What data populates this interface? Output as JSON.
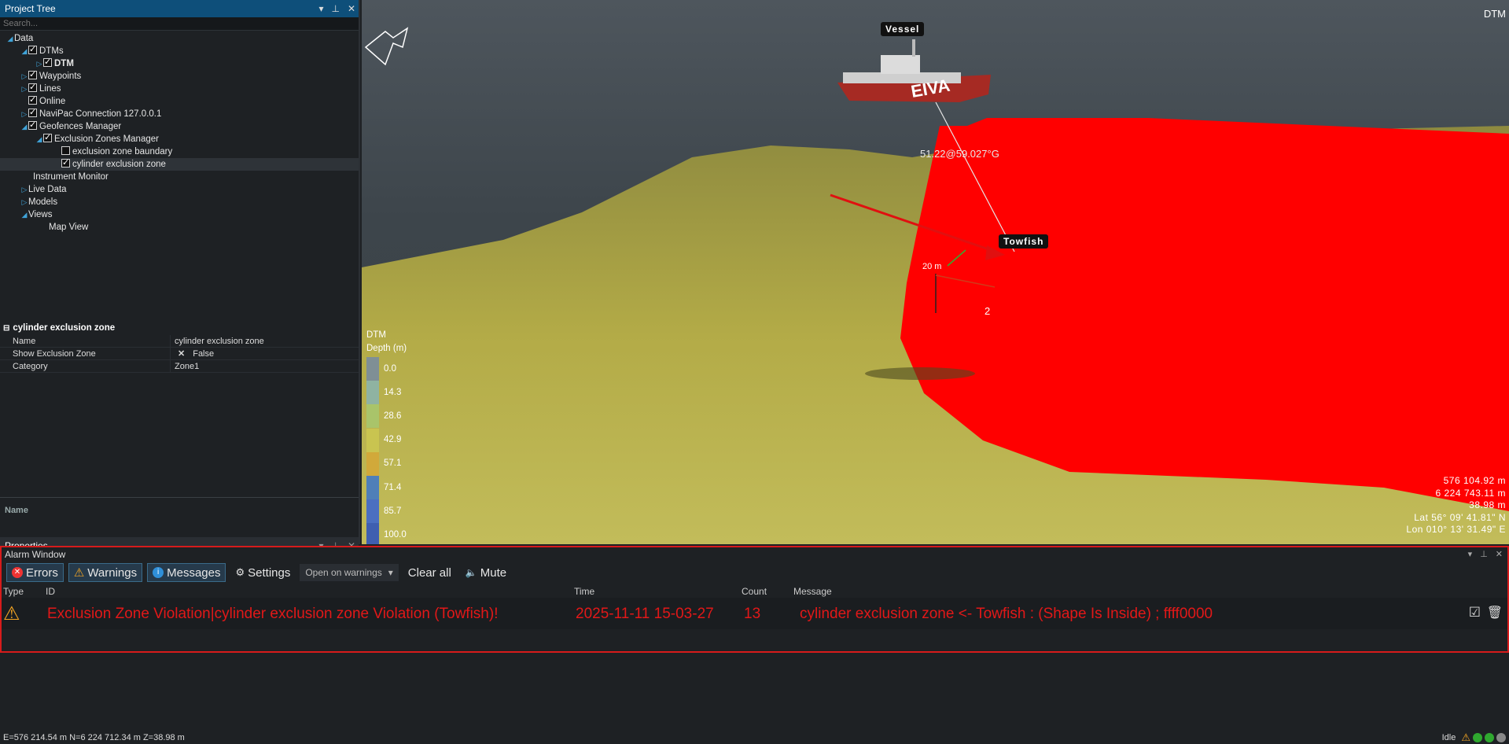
{
  "project_tree": {
    "title": "Project Tree",
    "search_placeholder": "Search...",
    "items": [
      {
        "label": "Data"
      },
      {
        "label": "DTMs"
      },
      {
        "label": "DTM"
      },
      {
        "label": "Waypoints"
      },
      {
        "label": "Lines"
      },
      {
        "label": "Online"
      },
      {
        "label": "NaviPac Connection 127.0.0.1"
      },
      {
        "label": "Geofences Manager"
      },
      {
        "label": "Exclusion Zones Manager"
      },
      {
        "label": "exclusion zone baundary"
      },
      {
        "label": "cylinder exclusion zone"
      },
      {
        "label": "Instrument Monitor"
      },
      {
        "label": "Live Data"
      },
      {
        "label": "Models"
      },
      {
        "label": "Views"
      },
      {
        "label": "Map View"
      }
    ]
  },
  "properties": {
    "title": "Properties",
    "object_name": "cylinder exclusion zone",
    "rows": [
      {
        "key": "Name",
        "value": "cylinder exclusion zone"
      },
      {
        "key": "Show Exclusion Zone",
        "value": "False"
      },
      {
        "key": "Category",
        "value": "Zone1"
      }
    ],
    "description_label": "Name"
  },
  "view": {
    "label_top_right": "DTM",
    "vessel_label": "Vessel",
    "towfish_label": "Towfish",
    "cable_label": "51.22@59.027°G",
    "scale_label": "20 m",
    "scale_label_2": "2",
    "legend_title_1": "DTM",
    "legend_title_2": "Depth (m)",
    "legend_values": [
      "0.0",
      "14.3",
      "28.6",
      "42.9",
      "57.1",
      "71.4",
      "85.7",
      "100.0"
    ],
    "legend_colors": [
      "#7f8f95",
      "#8fb3a2",
      "#a9c46a",
      "#c9c450",
      "#d1a93a",
      "#4f7fb8",
      "#4b6fc0",
      "#3f5fb0"
    ],
    "coords": [
      "576 104.92 m",
      "6 224 743.11 m",
      "38.98 m",
      "Lat 56° 09' 41.81\" N",
      "Lon 010° 13' 31.49\" E"
    ],
    "vessel_hull_text": "EIVA",
    "colors": {
      "exclusion_zone": "#ff0000",
      "seabed": "#b9b24a",
      "sky": "#4e565d"
    }
  },
  "alarm_window": {
    "title": "Alarm Window",
    "buttons": {
      "errors": "Errors",
      "warnings": "Warnings",
      "messages": "Messages",
      "settings": "Settings",
      "clear_all": "Clear all",
      "mute": "Mute"
    },
    "dropdown_value": "Open on warnings",
    "columns": {
      "type": "Type",
      "id": "ID",
      "time": "Time",
      "count": "Count",
      "message": "Message"
    },
    "rows": [
      {
        "id": "Exclusion Zone Violation|cylinder exclusion zone Violation (Towfish)!",
        "time": "2025-11-11 15-03-27",
        "count": "13",
        "message": "cylinder exclusion zone <- Towfish : (Shape Is Inside) ; ffff0000"
      }
    ]
  },
  "status_bar": {
    "position": "E=576 214.54 m N=6 224 712.34 m Z=38.98 m",
    "state": "Idle"
  }
}
